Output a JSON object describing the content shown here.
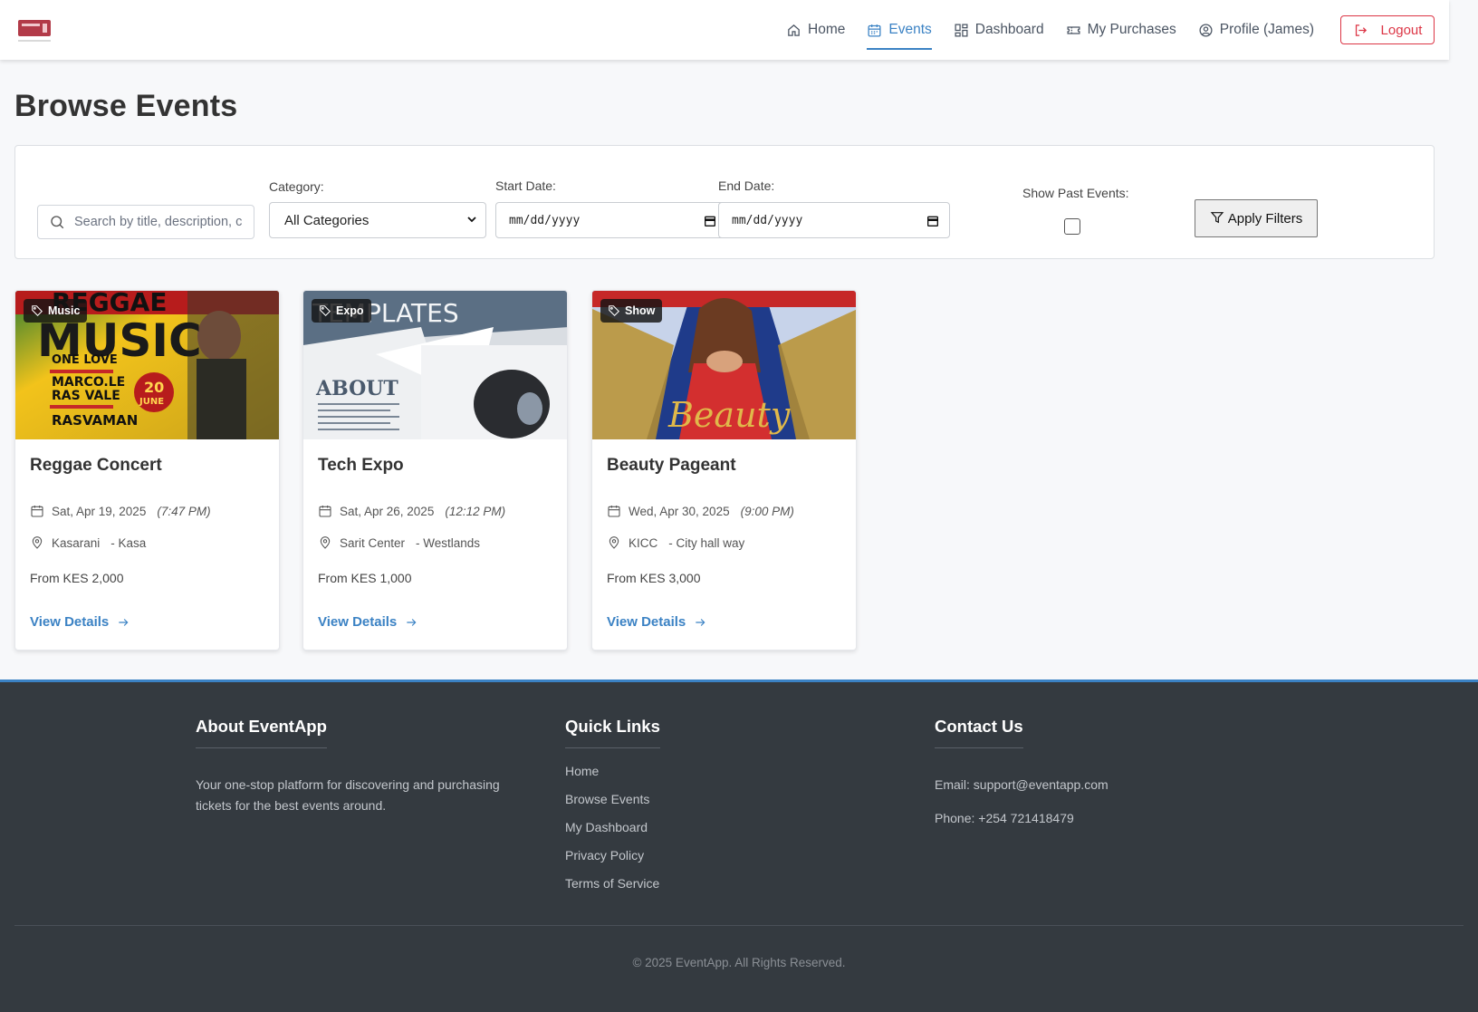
{
  "nav": {
    "items": [
      {
        "label": "Home",
        "icon": "home-icon",
        "active": false
      },
      {
        "label": "Events",
        "icon": "calendar-icon",
        "active": true
      },
      {
        "label": "Dashboard",
        "icon": "dashboard-icon",
        "active": false
      },
      {
        "label": "My Purchases",
        "icon": "ticket-icon",
        "active": false
      },
      {
        "label": "Profile (James)",
        "icon": "user-circle-icon",
        "active": false
      }
    ],
    "logout_label": "Logout"
  },
  "page": {
    "title": "Browse Events"
  },
  "filters": {
    "search_placeholder": "Search by title, description, c",
    "category_label": "Category:",
    "category_value": "All Categories",
    "start_date_label": "Start Date:",
    "start_date_value": "mm/dd/yyyy",
    "end_date_label": "End Date:",
    "end_date_value": "mm/dd/yyyy",
    "past_events_label": "Show Past Events:",
    "past_events_checked": false,
    "apply_label": "Apply Filters"
  },
  "events": [
    {
      "badge": "Music",
      "title": "Reggae Concert",
      "date": "Sat, Apr 19, 2025",
      "time": "(7:47 PM)",
      "venue": "Kasarani",
      "area": "- Kasa",
      "price": "From KES 2,000",
      "link": "View Details"
    },
    {
      "badge": "Expo",
      "title": "Tech Expo",
      "date": "Sat, Apr 26, 2025",
      "time": "(12:12 PM)",
      "venue": "Sarit Center",
      "area": "- Westlands",
      "price": "From KES 1,000",
      "link": "View Details"
    },
    {
      "badge": "Show",
      "title": "Beauty Pageant",
      "date": "Wed, Apr 30, 2025",
      "time": "(9:00 PM)",
      "venue": "KICC",
      "area": "- City hall way",
      "price": "From KES 3,000",
      "link": "View Details"
    }
  ],
  "poster_text": {
    "reggae_top": "REGGAE",
    "reggae_main": "MUSIC",
    "reggae_line1": "ONE LOVE",
    "reggae_line2": "MARCO.LE",
    "reggae_line3": "RAS VALE",
    "reggae_line4": "RASVAMAN",
    "reggae_day": "20",
    "reggae_month": "JUNE",
    "expo_top": "TEMPLATES",
    "expo_about": "ABOUT",
    "pageant_script": "Beauty"
  },
  "footer": {
    "about_title": "About EventApp",
    "about_text_1": "Your one-stop platform for discovering and purchasing",
    "about_text_2": "tickets for the best events around.",
    "links_title": "Quick Links",
    "links": [
      "Home",
      "Browse Events",
      "My Dashboard",
      "Privacy Policy",
      "Terms of Service"
    ],
    "contact_title": "Contact Us",
    "email": "Email: support@eventapp.com",
    "phone": "Phone: +254 721418479",
    "copyright": "© 2025 EventApp. All Rights Reserved."
  },
  "colors": {
    "accent": "#3b82c4",
    "danger": "#dc3545",
    "footer_bg": "#343a40"
  }
}
